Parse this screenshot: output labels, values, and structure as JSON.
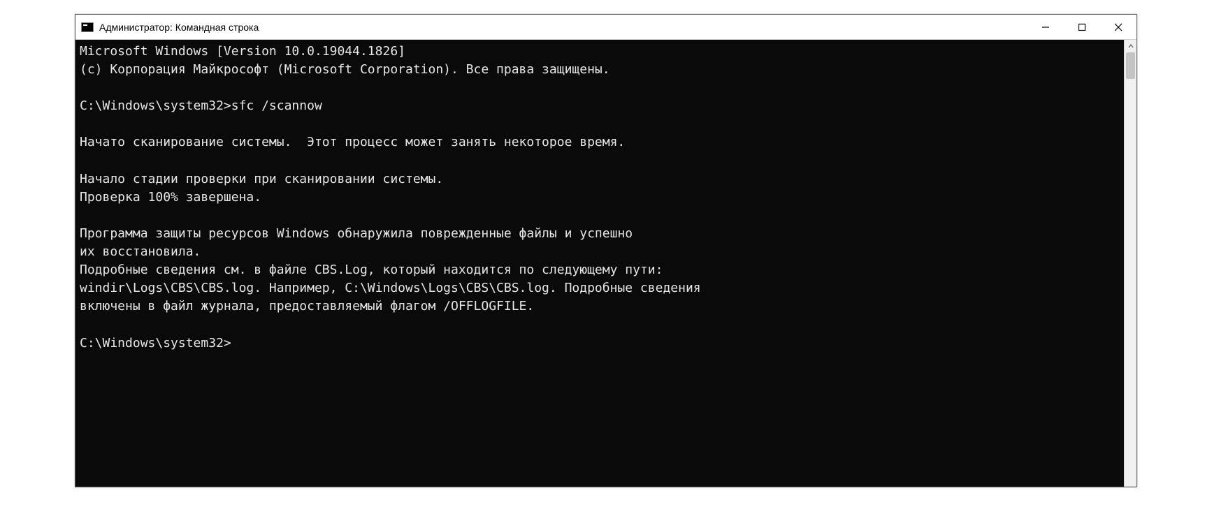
{
  "window": {
    "title": "Администратор: Командная строка"
  },
  "terminal": {
    "lines": [
      "Microsoft Windows [Version 10.0.19044.1826]",
      "(c) Корпорация Майкрософт (Microsoft Corporation). Все права защищены.",
      "",
      "C:\\Windows\\system32>sfc /scannow",
      "",
      "Начато сканирование системы.  Этот процесс может занять некоторое время.",
      "",
      "Начало стадии проверки при сканировании системы.",
      "Проверка 100% завершена.",
      "",
      "Программа защиты ресурсов Windows обнаружила поврежденные файлы и успешно",
      "их восстановила.",
      "Подробные сведения см. в файле CBS.Log, который находится по следующему пути:",
      "windir\\Logs\\CBS\\CBS.log. Например, C:\\Windows\\Logs\\CBS\\CBS.log. Подробные сведения",
      "включены в файл журнала, предоставляемый флагом /OFFLOGFILE.",
      "",
      "C:\\Windows\\system32>"
    ]
  }
}
